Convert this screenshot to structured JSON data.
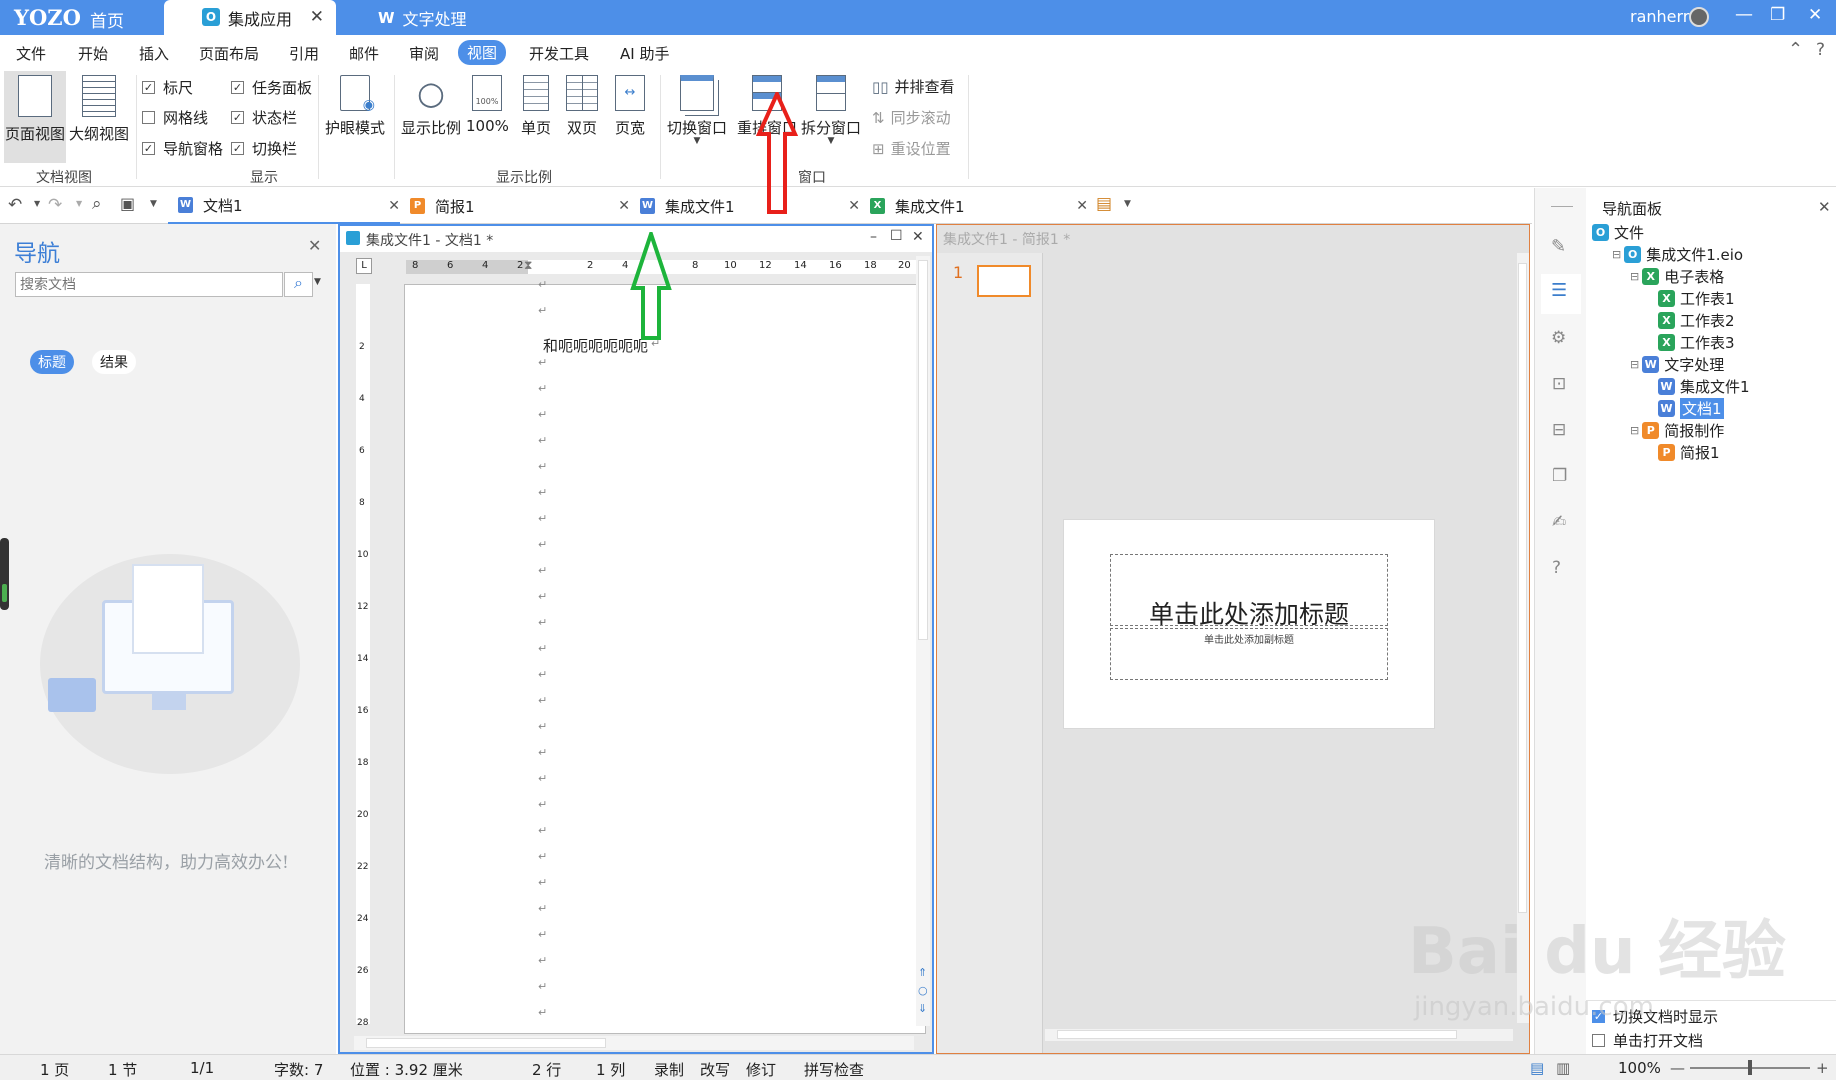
{
  "titlebar": {
    "logo": "YOZO",
    "home_label": "首页",
    "tabs": [
      {
        "label": "集成应用"
      },
      {
        "label": "文字处理"
      }
    ],
    "user_name": "ranherr"
  },
  "menubar": {
    "items": [
      "文件",
      "开始",
      "插入",
      "页面布局",
      "引用",
      "邮件",
      "审阅",
      "视图",
      "开发工具",
      "AI 助手"
    ],
    "active": "视图"
  },
  "ribbon": {
    "page_view": "页面视图",
    "outline_view": "大纲视图",
    "doc_view_group": "文档视图",
    "checks": [
      {
        "label": "标尺",
        "checked": true
      },
      {
        "label": "任务面板",
        "checked": true
      },
      {
        "label": "网格线",
        "checked": false
      },
      {
        "label": "状态栏",
        "checked": true
      },
      {
        "label": "导航窗格",
        "checked": true
      },
      {
        "label": "切换栏",
        "checked": true
      }
    ],
    "display_group": "显示",
    "eye_mode": "护眼模式",
    "zoom": "显示比例",
    "zoom100": "100%",
    "zoom100_icon_text": "100%",
    "single_page": "单页",
    "double_page": "双页",
    "page_width": "页宽",
    "zoom_group": "显示比例",
    "switch_window": "切换窗口",
    "arrange_window": "重排窗口",
    "split_window": "拆分窗口",
    "window_group": "窗口",
    "side_by_side": "并排查看",
    "sync_scroll": "同步滚动",
    "reset_position": "重设位置"
  },
  "doc_tabs": [
    {
      "label": "文档1",
      "type": "W"
    },
    {
      "label": "简报1",
      "type": "P"
    },
    {
      "label": "集成文件1",
      "type": "O"
    },
    {
      "label": "集成文件1",
      "type": "X"
    }
  ],
  "nav_left": {
    "title": "导航",
    "search_placeholder": "搜索文档",
    "tab_heading": "标题",
    "tab_results": "结果",
    "slogan": "清晰的文档结构，助力高效办公!"
  },
  "doc_window": {
    "title": "集成文件1 - 文档1 *",
    "ruler_numbers": [
      "8",
      "6",
      "4",
      "2",
      "2",
      "4",
      "8",
      "10",
      "12",
      "14",
      "16",
      "18",
      "20"
    ],
    "vruler_numbers": [
      "2",
      "4",
      "6",
      "8",
      "10",
      "12",
      "14",
      "16",
      "18",
      "20",
      "22",
      "24",
      "26",
      "28"
    ],
    "text_line": "和呃呃呃呃呃呃",
    "return_mark": "↵"
  },
  "slide_window": {
    "title": "集成文件1 - 简报1 *",
    "slide_number": "1",
    "slide_title": "单击此处添加标题",
    "slide_subtitle": "单击此处添加副标题"
  },
  "nav_panel": {
    "title": "导航面板",
    "tree": [
      {
        "label": "文件",
        "type": "O",
        "level": 0
      },
      {
        "label": "集成文件1.eio",
        "type": "O",
        "level": 1
      },
      {
        "label": "电子表格",
        "type": "X",
        "level": 2
      },
      {
        "label": "工作表1",
        "type": "X",
        "level": 3
      },
      {
        "label": "工作表2",
        "type": "X",
        "level": 3
      },
      {
        "label": "工作表3",
        "type": "X",
        "level": 3
      },
      {
        "label": "文字处理",
        "type": "W",
        "level": 2
      },
      {
        "label": "集成文件1",
        "type": "W",
        "level": 3
      },
      {
        "label": "文档1",
        "type": "W",
        "level": 3
      },
      {
        "label": "简报制作",
        "type": "P",
        "level": 2
      },
      {
        "label": "简报1",
        "type": "P",
        "level": 3
      }
    ],
    "selected": "文档1",
    "opt_switch_show": "切换文档时显示",
    "opt_single_click": "单击打开文档"
  },
  "statusbar": {
    "page": "1 页",
    "section": "1 节",
    "pages": "1/1",
    "words": "字数: 7",
    "position": "位置 : 3.92 厘米",
    "row": "2 行",
    "col": "1 列",
    "record": "录制",
    "overwrite": "改写",
    "revise": "修订",
    "spell": "拼写检查",
    "zoom": "100%"
  },
  "watermark": {
    "text": "Bai du 经验",
    "sub": "jingyan.baidu.com"
  },
  "colors": {
    "accent": "#4d8fe8",
    "word": "#4a7fd8",
    "excel": "#2aa45b",
    "present": "#f08a2a",
    "integrated": "#2a9fd6",
    "red_arrow": "#e8201a",
    "green_arrow": "#1db43b"
  }
}
